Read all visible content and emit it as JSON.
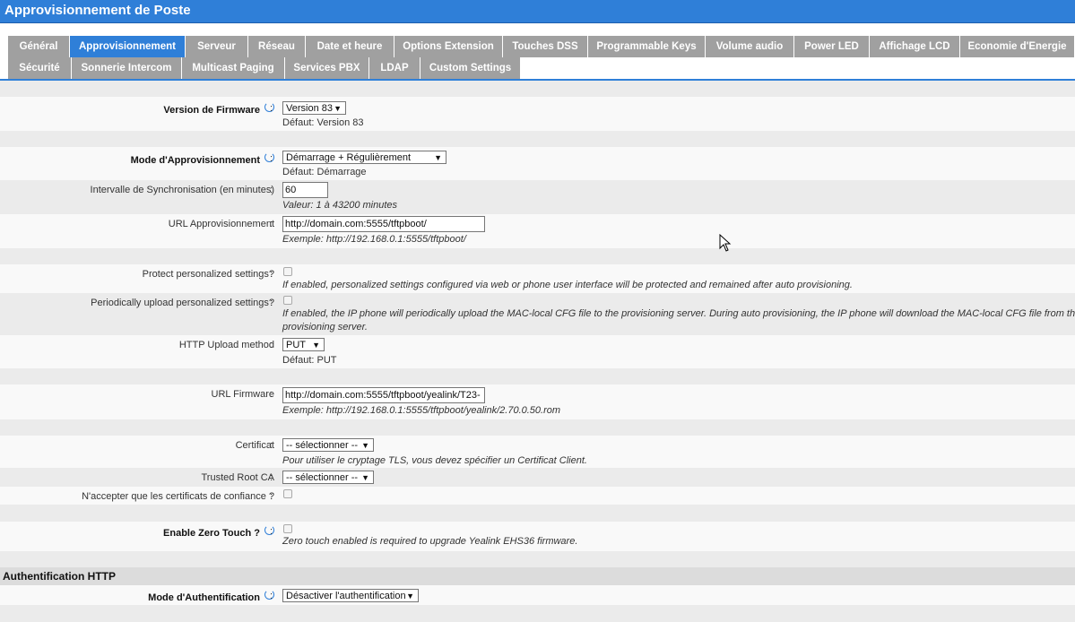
{
  "window": {
    "title": "Approvisionnement de Poste"
  },
  "tabs_row1": [
    "Général",
    "Approvisionnement",
    "Serveur",
    "Réseau",
    "Date et heure",
    "Options Extension",
    "Touches DSS",
    "Programmable Keys",
    "Volume audio",
    "Power LED",
    "Affichage LCD",
    "Economie d'Energie"
  ],
  "tabs_row2": [
    "Sécurité",
    "Sonnerie Intercom",
    "Multicast Paging",
    "Services PBX",
    "LDAP",
    "Custom Settings"
  ],
  "active_tab": "Approvisionnement",
  "colors": {
    "accent": "#2f7fd8",
    "tab_inactive": "#a0a0a0"
  },
  "form": {
    "firmware_version": {
      "label": "Version de Firmware",
      "value": "Version 83",
      "default": "Défaut: Version 83"
    },
    "provisioning_mode": {
      "label": "Mode d'Approvisionnement",
      "value": "Démarrage + Régulièrement",
      "default": "Défaut: Démarrage"
    },
    "sync_interval": {
      "label": "Intervalle de Synchronisation (en minutes)",
      "value": "60",
      "hint": "Valeur: 1 à 43200 minutes"
    },
    "provisioning_url": {
      "label": "URL Approvisionnement",
      "value": "http://domain.com:5555/tftpboot/",
      "hint": "Exemple: http://192.168.0.1:5555/tftpboot/"
    },
    "protect_settings": {
      "label": "Protect personalized settings?",
      "checked": false,
      "hint": "If enabled, personalized settings configured via web or phone user interface will be protected and remained after auto provisioning."
    },
    "upload_settings": {
      "label": "Periodically upload personalized settings?",
      "checked": false,
      "hint_line1": "If enabled, the IP phone will periodically upload the MAC-local CFG file to the provisioning server. During auto provisioning, the IP phone will download the MAC-local CFG file from the",
      "hint_line2": "provisioning server."
    },
    "http_upload_method": {
      "label": "HTTP Upload method",
      "value": "PUT",
      "default": "Défaut: PUT"
    },
    "firmware_url": {
      "label": "URL Firmware",
      "value": "http://domain.com:5555/tftpboot/yealink/T23-",
      "hint": "Exemple: http://192.168.0.1:5555/tftpboot/yealink/2.70.0.50.rom"
    },
    "certificate": {
      "label": "Certificat",
      "value": "-- sélectionner --",
      "hint": "Pour utiliser le cryptage TLS, vous devez spécifier un Certificat Client."
    },
    "trusted_root_ca": {
      "label": "Trusted Root CA",
      "value": "-- sélectionner --"
    },
    "trusted_only": {
      "label": "N'accepter que les certificats de confiance ?",
      "checked": false
    },
    "zero_touch": {
      "label": "Enable Zero Touch ?",
      "checked": false,
      "hint": "Zero touch enabled is required to upgrade Yealink EHS36 firmware."
    }
  },
  "auth_section": {
    "title": "Authentification HTTP",
    "mode": {
      "label": "Mode d'Authentification",
      "value": "Désactiver l'authentification"
    }
  },
  "colon": ":"
}
